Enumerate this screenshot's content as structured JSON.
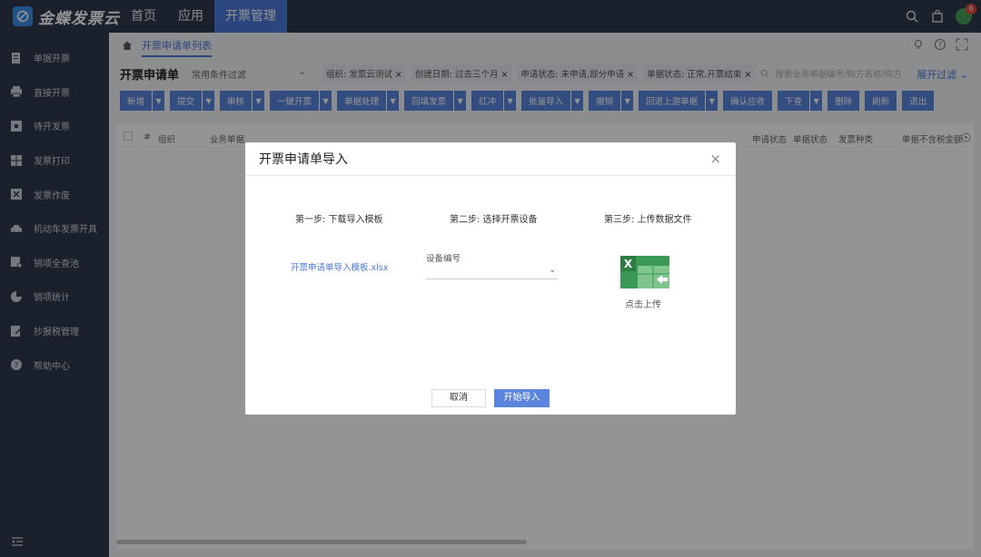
{
  "topbar": {
    "app_name": "金蝶发票云",
    "nav": [
      "首页",
      "应用",
      "开票管理"
    ],
    "active_nav": "开票管理",
    "notification_count": "6"
  },
  "sidebar": {
    "items": [
      "单据开票",
      "直接开票",
      "待开发票",
      "发票打印",
      "发票作废",
      "机动车发票开具",
      "销项全查池",
      "销项统计",
      "抄报税管理",
      "帮助中心"
    ]
  },
  "breadcrumb": {
    "current": "开票申请单列表"
  },
  "list": {
    "title": "开票申请单",
    "scheme": "常用条件过滤",
    "chips": [
      "组织: 发票云测试",
      "创建日期: 过去三个月",
      "申请状态: 未申请,部分申请",
      "单据状态: 正常,开票结束"
    ],
    "search_placeholder": "搜索业务单据编号/购方名称/购方",
    "expand_filter": "展开过滤"
  },
  "toolbar": {
    "buttons": [
      {
        "label": "新增",
        "dropdown": true
      },
      {
        "label": "提交",
        "dropdown": true
      },
      {
        "label": "审核",
        "dropdown": true
      },
      {
        "label": "一键开票",
        "dropdown": true
      },
      {
        "label": "单据处理",
        "dropdown": true
      },
      {
        "label": "回填发票",
        "dropdown": true
      },
      {
        "label": "红冲",
        "dropdown": true
      },
      {
        "label": "批量导入",
        "dropdown": true
      },
      {
        "label": "撤销",
        "dropdown": true
      },
      {
        "label": "回退上游单据",
        "dropdown": true
      },
      {
        "label": "确认应收",
        "dropdown": false
      },
      {
        "label": "下查",
        "dropdown": true
      },
      {
        "label": "删除",
        "dropdown": false
      },
      {
        "label": "刷新",
        "dropdown": false
      },
      {
        "label": "退出",
        "dropdown": false
      }
    ]
  },
  "grid": {
    "columns": [
      "#",
      "组织",
      "业务单据",
      "申请状态",
      "单据状态",
      "发票种类",
      "单据不含税金额"
    ]
  },
  "modal": {
    "title": "开票申请单导入",
    "step1": "第一步: 下载导入模板",
    "step2": "第二步: 选择开票设备",
    "step3": "第三步: 上传数据文件",
    "template_link": "开票申请单导入模板.xlsx",
    "device_label": "设备编号",
    "device_value": "",
    "upload_label": "点击上传",
    "cancel": "取消",
    "start": "开始导入"
  },
  "colors": {
    "topbar": "#2e3a4f",
    "sidebar": "#2f3a4c",
    "accent": "#4a78d9",
    "button": "#5b85dd",
    "excel": "#3a9a55"
  }
}
